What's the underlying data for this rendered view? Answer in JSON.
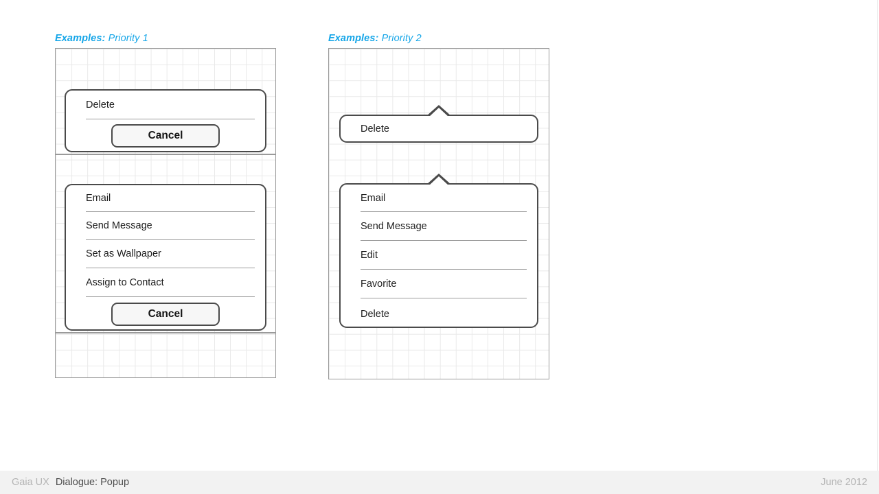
{
  "page": {
    "footer": {
      "brand": "Gaia UX",
      "title": "Dialogue: Popup",
      "date": "June 2012"
    },
    "accent_color": "#16a6e8",
    "border_color": "#4a4a4a",
    "separator_color": "#9b9b9b",
    "frame_color": "#9a9a9a",
    "grid_color": "#e9e9e9",
    "footer_bg": "#f2f2f2"
  },
  "examples": [
    {
      "label_lead": "Examples:",
      "label_rest": " Priority 1",
      "screens": [
        {
          "dialog": {
            "style": "sheet",
            "items": [
              "Delete"
            ],
            "cancel_label": "Cancel"
          }
        },
        {
          "dialog": {
            "style": "sheet",
            "items": [
              "Email",
              "Send Message",
              "Set as Wallpaper",
              "Assign to Contact"
            ],
            "cancel_label": "Cancel"
          }
        }
      ]
    },
    {
      "label_lead": "Examples:",
      "label_rest": " Priority 2",
      "screens": [
        {
          "dialog": {
            "style": "bubble",
            "items": [
              "Delete"
            ],
            "cancel_label": null
          }
        },
        {
          "dialog": {
            "style": "bubble",
            "items": [
              "Email",
              "Send Message",
              "Edit",
              "Favorite",
              "Delete"
            ],
            "cancel_label": null
          }
        }
      ]
    }
  ]
}
